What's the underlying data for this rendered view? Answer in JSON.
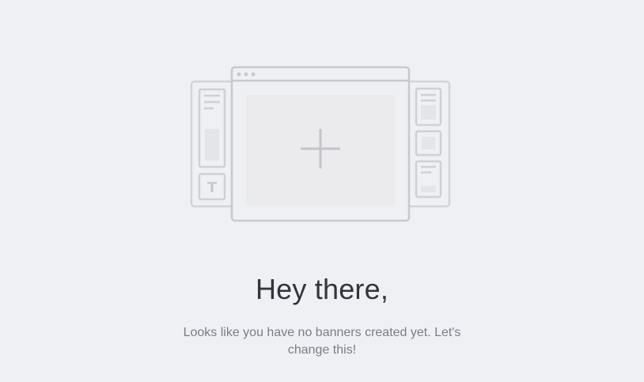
{
  "empty_state": {
    "illustration_icon": "banner-editor-plus-illustration",
    "placeholder_glyph": "T",
    "title": "Hey there,",
    "message": "Looks like you have no banners created yet. Let's change this!"
  },
  "colors": {
    "background": "#eff0f4",
    "illustration_stroke": "#c8c9ce",
    "illustration_fill": "#ebebee",
    "title_text": "#33353d",
    "message_text": "#7a7d87"
  }
}
